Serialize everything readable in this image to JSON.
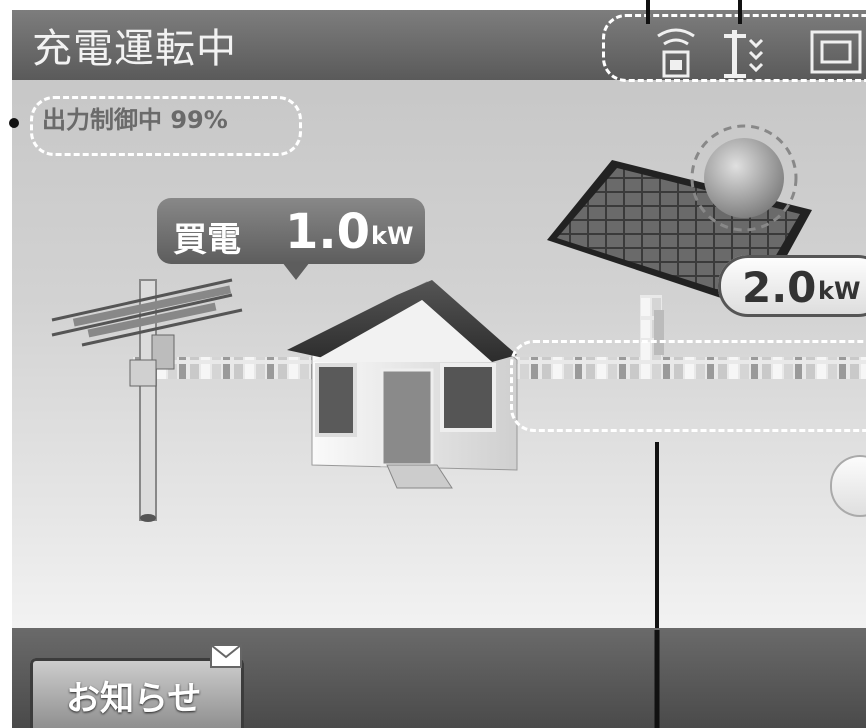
{
  "header": {
    "title": "充電運転中"
  },
  "status": {
    "output_control": "出力制御中 99%"
  },
  "flows": {
    "buy_label": "買電",
    "buy_value": "1.0",
    "buy_unit": "kW",
    "gen_value": "2.0",
    "gen_unit": "kW"
  },
  "footer": {
    "notice_button": "お知らせ"
  },
  "icons": [
    "communication-icon",
    "signal-icon",
    "battery-icon"
  ],
  "colors": {
    "titlebar": "#5a5a5a",
    "screen_bg": "#d2d2d2",
    "dash": "#ffffff"
  }
}
